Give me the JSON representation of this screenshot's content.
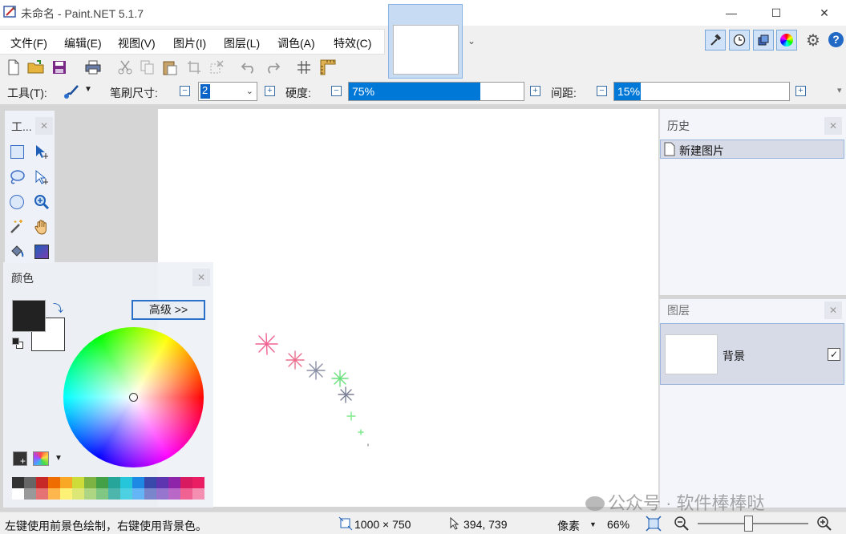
{
  "window": {
    "title": "未命名 - Paint.NET 5.1.7",
    "minimize": "—",
    "maximize": "☐",
    "close": "✕"
  },
  "menu": [
    "文件(F)",
    "编辑(E)",
    "视图(V)",
    "图片(I)",
    "图层(L)",
    "调色(A)",
    "特效(C)"
  ],
  "toolbar": {
    "tool_label": "工具(T):",
    "brush_label": "笔刷尺寸:",
    "brush_value": "2",
    "hardness_label": "硬度:",
    "hardness_value": "75%",
    "hardness_fraction": 0.75,
    "spacing_label": "间距:",
    "spacing_value": "15%",
    "spacing_fraction": 0.15,
    "minus": "−",
    "plus": "+"
  },
  "tools_panel": {
    "title": "工..."
  },
  "colors_panel": {
    "title": "颜色",
    "advanced_button": "高级 >>",
    "primary_color": "#222222",
    "secondary_color": "#ffffff"
  },
  "palette": [
    "#333333",
    "#666666",
    "#c62828",
    "#ef6c00",
    "#f9a825",
    "#cddc39",
    "#7cb342",
    "#43a047",
    "#26a69a",
    "#26c6da",
    "#1e88e5",
    "#3949ab",
    "#5e35b1",
    "#8e24aa",
    "#d81b60",
    "#e91e63",
    "#ffffff",
    "#999999",
    "#e57373",
    "#ffb74d",
    "#fff176",
    "#dce775",
    "#aed581",
    "#81c784",
    "#4db6ac",
    "#4dd0e1",
    "#64b5f6",
    "#7986cb",
    "#9575cd",
    "#ba68c8",
    "#f06292",
    "#f48fb1"
  ],
  "history_panel": {
    "title": "历史",
    "items": [
      "新建图片"
    ]
  },
  "layers_panel": {
    "title": "图层",
    "layers": [
      {
        "name": "背景",
        "visible": "✓"
      }
    ]
  },
  "status": {
    "hint": "左键使用前景色绘制，右键使用背景色。",
    "size": "1000 × 750",
    "position": "394, 739",
    "unit": "像素",
    "zoom": "66%"
  },
  "watermark": "公众号 · 软件棒棒哒"
}
